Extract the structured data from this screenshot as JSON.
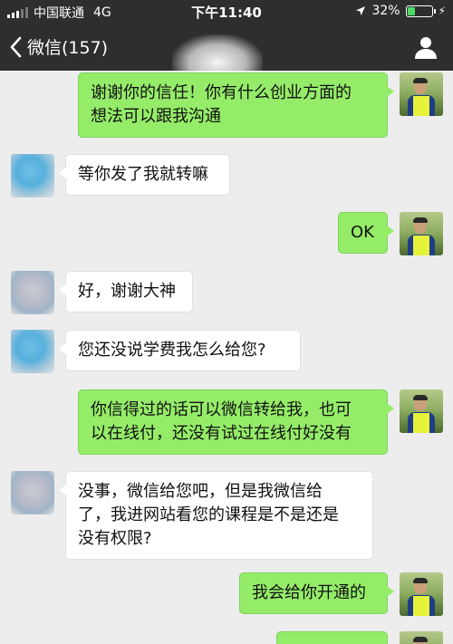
{
  "status_bar": {
    "carrier": "中国联通",
    "network": "4G",
    "time": "下午11:40",
    "battery_percent": "32%",
    "battery_level": 0.32
  },
  "nav": {
    "back_label": "微信(157)",
    "back_icon": "chevron-left-icon",
    "profile_icon": "person-icon"
  },
  "colors": {
    "bubble_self": "#95ec69",
    "bubble_other": "#ffffff",
    "bar": "#2e2e2e",
    "background": "#ededed"
  },
  "messages": [
    {
      "from": "self",
      "lines": [
        "谢谢你的信任！你有什么创业方面的",
        "想法可以跟我沟通"
      ]
    },
    {
      "from": "other",
      "lines": [
        "等你发了我就转嘛"
      ]
    },
    {
      "from": "self",
      "lines": [
        "OK"
      ]
    },
    {
      "from": "other",
      "lines": [
        "好，谢谢大神"
      ]
    },
    {
      "from": "other",
      "lines": [
        "您还没说学费我怎么给您?"
      ]
    },
    {
      "from": "self",
      "lines": [
        "你信得过的话可以微信转给我，也可",
        "以在线付，还没有试过在线付好没有"
      ]
    },
    {
      "from": "other",
      "lines": [
        "没事，微信给您吧，但是我微信给",
        "了，我进网站看您的课程是不是还是",
        "没有权限?"
      ]
    },
    {
      "from": "self",
      "lines": [
        "我会给你开通的"
      ]
    },
    {
      "from": "self",
      "lines": [
        ""
      ]
    }
  ]
}
